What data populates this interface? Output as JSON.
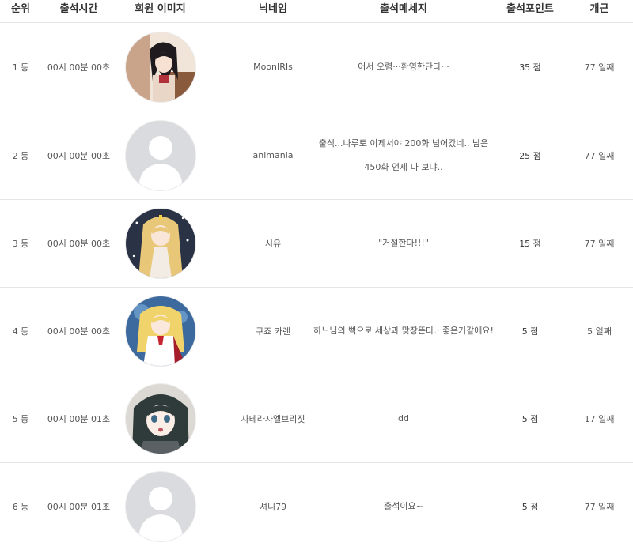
{
  "headers": {
    "rank": "순위",
    "time": "출석시간",
    "avatar": "회원 이미지",
    "nickname": "닉네임",
    "message": "출석메세지",
    "points": "출석포인트",
    "streak": "개근"
  },
  "rows": [
    {
      "rank": "1 등",
      "time": "00시 00분 00초",
      "avatar": "anime-girl-dark-hair-avatar",
      "nickname": "MoonIRIs",
      "message": "어서 오렴···환영한단다···",
      "points": "35 점",
      "streak": "77 일째"
    },
    {
      "rank": "2 등",
      "time": "00시 00분 00초",
      "avatar": "default-user-avatar",
      "nickname": "animania",
      "message": "출석...나루토 이제서야 200화 넘어갔네.. 남은 450화 언제 다 보냐..",
      "points": "25 점",
      "streak": "77 일째"
    },
    {
      "rank": "3 등",
      "time": "00시 00분 00초",
      "avatar": "anime-girl-blonde-avatar",
      "nickname": "시유",
      "message": "\"거절한다!!!\"",
      "points": "15 점",
      "streak": "77 일째"
    },
    {
      "rank": "4 등",
      "time": "00시 00분 00초",
      "avatar": "anime-girl-blonde-red-avatar",
      "nickname": "쿠죠 카렌",
      "message": "하느님의 뻑으로 세상과 맞장뜬다.· 좋은거같에요!",
      "points": "5 점",
      "streak": "5 일째"
    },
    {
      "rank": "5 등",
      "time": "00시 00분 01초",
      "avatar": "anime-girl-dark-teal-avatar",
      "nickname": "사테라자엘브리짓",
      "message": "dd",
      "points": "5 점",
      "streak": "17 일째"
    },
    {
      "rank": "6 등",
      "time": "00시 00분 01초",
      "avatar": "default-user-avatar",
      "nickname": "셔니79",
      "message": "출석이요~",
      "points": "5 점",
      "streak": "77 일째"
    }
  ]
}
